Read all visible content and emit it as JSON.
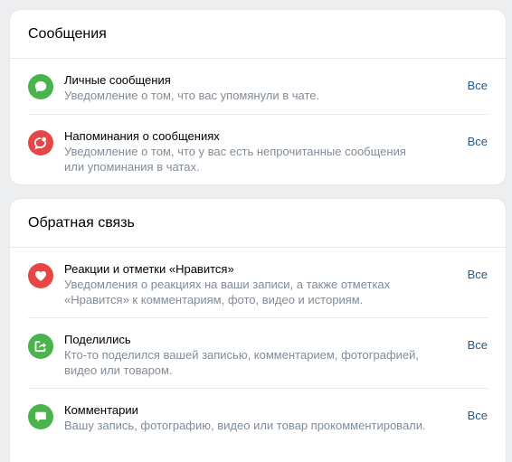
{
  "sections": [
    {
      "title": "Сообщения",
      "items": [
        {
          "title": "Личные сообщения",
          "description": "Уведомление о том, что вас упомянули в чате.",
          "action": "Все",
          "icon": "message-icon",
          "icon_color": "#4bb34b"
        },
        {
          "title": "Напоминания о сообщениях",
          "description": "Уведомление о том, что у вас есть непрочитанные сообщения или упоминания в чатах.",
          "action": "Все",
          "icon": "message-reminder-icon",
          "icon_color": "#e64646"
        }
      ]
    },
    {
      "title": "Обратная связь",
      "items": [
        {
          "title": "Реакции и отметки «Нравится»",
          "description": "Уведомления о реакциях на ваши записи, а также отметках «Нравится» к комментариям, фото, видео и историям.",
          "action": "Все",
          "icon": "heart-icon",
          "icon_color": "#e64646"
        },
        {
          "title": "Поделились",
          "description": "Кто-то поделился вашей записью, комментарием, фотографией, видео или товаром.",
          "action": "Все",
          "icon": "share-icon",
          "icon_color": "#4bb34b"
        },
        {
          "title": "Комментарии",
          "description": "Вашу запись, фотографию, видео или товар прокомментировали.",
          "action": "Все",
          "icon": "comment-icon",
          "icon_color": "#4bb34b"
        }
      ]
    }
  ]
}
